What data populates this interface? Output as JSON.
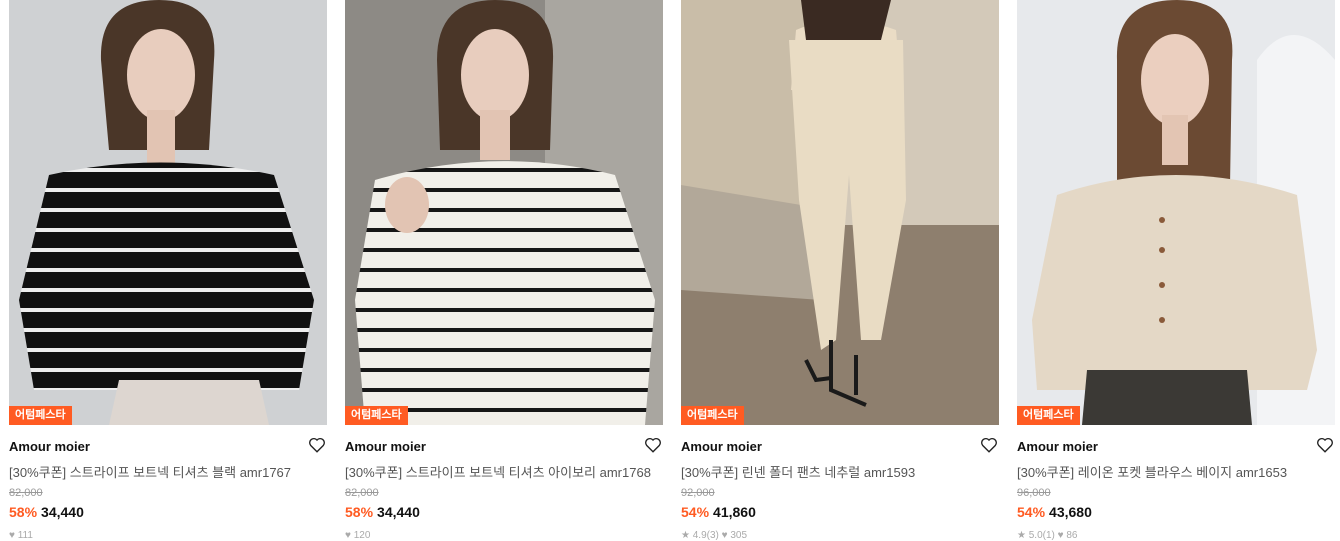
{
  "colors": {
    "accent": "#ff5b22",
    "text": "#111111",
    "muted": "#999999"
  },
  "products": [
    {
      "badge": "어텀페스타",
      "brand": "Amour moier",
      "name": "[30%쿠폰] 스트라이프 보트넥 티셔츠 블랙 amr1767",
      "original_price": "82,000",
      "discount": "58%",
      "price": "34,440",
      "meta": "♥ 111"
    },
    {
      "badge": "어텀페스타",
      "brand": "Amour moier",
      "name": "[30%쿠폰] 스트라이프 보트넥 티셔츠 아이보리 amr1768",
      "original_price": "82,000",
      "discount": "58%",
      "price": "34,440",
      "meta": "♥ 120"
    },
    {
      "badge": "어텀페스타",
      "brand": "Amour moier",
      "name": "[30%쿠폰] 린넨 폴더 팬츠 네추럴 amr1593",
      "original_price": "92,000",
      "discount": "54%",
      "price": "41,860",
      "meta": "★ 4.9(3)  ♥ 305"
    },
    {
      "badge": "어텀페스타",
      "brand": "Amour moier",
      "name": "[30%쿠폰] 레이온 포켓 블라우스 베이지 amr1653",
      "original_price": "96,000",
      "discount": "54%",
      "price": "43,680",
      "meta": "★ 5.0(1)  ♥ 86"
    }
  ]
}
